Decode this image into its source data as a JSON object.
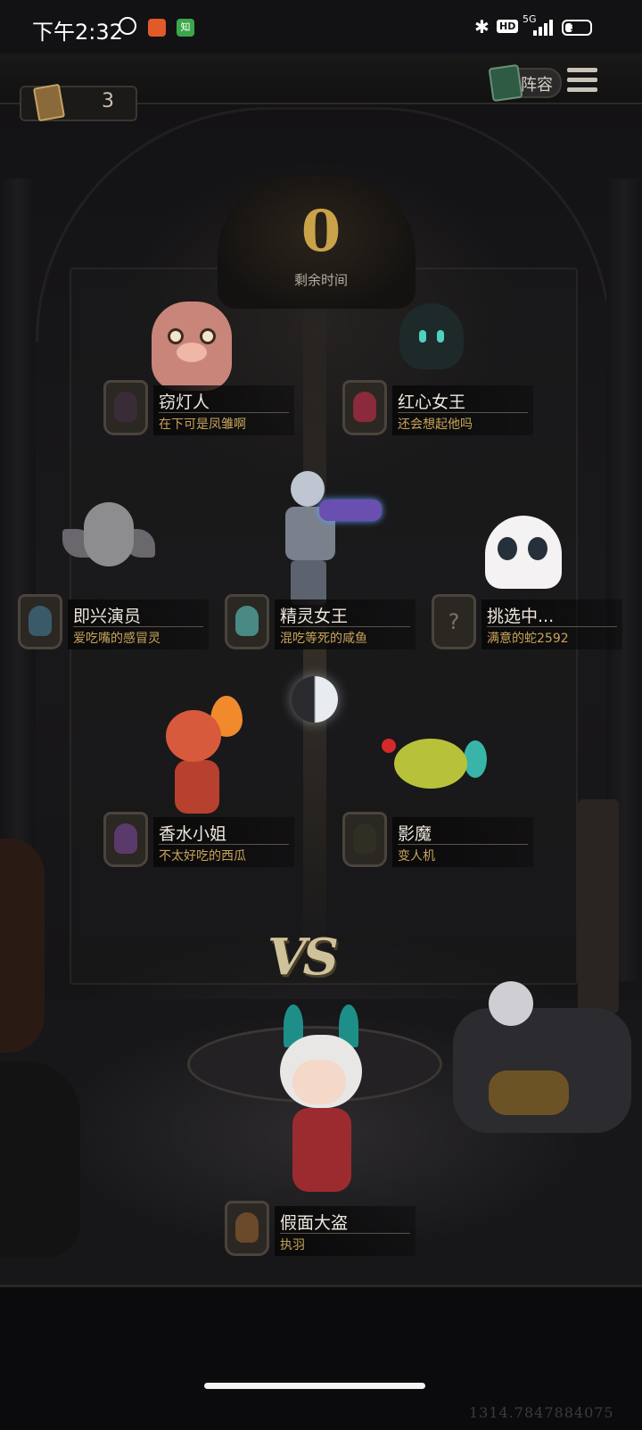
{
  "status_bar": {
    "time": "下午2:32",
    "app_icons": [
      {
        "icon": "orange-app-icon"
      },
      {
        "icon": "zhihu-app-icon",
        "label": "知"
      }
    ],
    "bluetooth_icon": "bluetooth-icon",
    "hd_badge": "HD",
    "network": "5G",
    "battery": "30",
    "battery_level": 0.3
  },
  "header": {
    "card_count": "3",
    "lineup_button": "阵容",
    "menu_icon": "hamburger-menu-icon"
  },
  "timer": {
    "value": "0",
    "label": "剩余时间"
  },
  "players": [
    {
      "hero": "窃灯人",
      "nick": "在下可是凤雏啊",
      "avatar_color": "#3a2c36"
    },
    {
      "hero": "红心女王",
      "nick": "还会想起他吗",
      "avatar_color": "#8a2a3a"
    },
    {
      "hero": "即兴演员",
      "nick": "爱吃嘴的感冒灵",
      "avatar_color": "#3a5a6a"
    },
    {
      "hero": "精灵女王",
      "nick": "混吃等死的咸鱼",
      "avatar_color": "#4a8a84"
    },
    {
      "hero": "挑选中...",
      "nick": "满意的蛇2592",
      "unknown": "?"
    },
    {
      "hero": "香水小姐",
      "nick": "不太好吃的西瓜",
      "avatar_color": "#5a3a6a"
    },
    {
      "hero": "影魔",
      "nick": "变人机",
      "avatar_color": "#2f2f24"
    }
  ],
  "vs_label": "VS",
  "self_player": {
    "hero": "假面大盗",
    "nick": "执羽",
    "avatar_color": "#6a4a2a"
  },
  "watermark": "1314.7847884075"
}
